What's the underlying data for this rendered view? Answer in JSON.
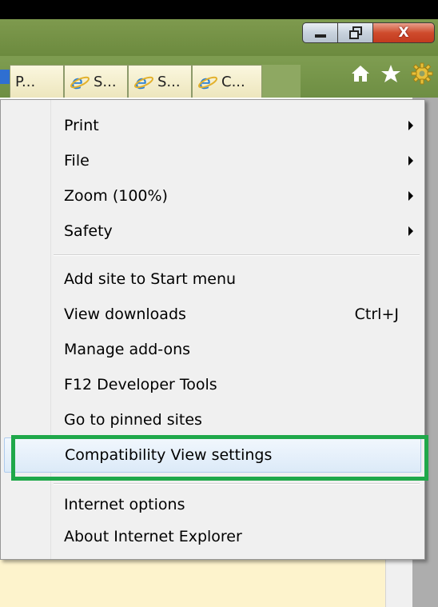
{
  "window": {
    "caption_buttons": {
      "minimize_icon": "minimize-icon",
      "restore_icon": "restore-icon",
      "close_label": "X"
    }
  },
  "tabs": [
    {
      "label": "P...",
      "icon": "none"
    },
    {
      "label": "S...",
      "icon": "ie-icon"
    },
    {
      "label": "S...",
      "icon": "ie-icon"
    },
    {
      "label": "C...",
      "icon": "ie-icon"
    }
  ],
  "toolbar": {
    "icons": [
      "home-icon",
      "star-icon",
      "gear-icon"
    ],
    "gear_color": "#e8c03a"
  },
  "menu": {
    "items_group1": [
      {
        "label": "Print",
        "submenu": true
      },
      {
        "label": "File",
        "submenu": true
      },
      {
        "label": "Zoom (100%)",
        "submenu": true
      },
      {
        "label": "Safety",
        "submenu": true
      }
    ],
    "items_group2": [
      {
        "label": "Add site to Start menu",
        "shortcut": ""
      },
      {
        "label": "View downloads",
        "shortcut": "Ctrl+J"
      },
      {
        "label": "Manage add-ons",
        "shortcut": ""
      },
      {
        "label": "F12 Developer Tools",
        "shortcut": ""
      },
      {
        "label": "Go to pinned sites",
        "shortcut": ""
      },
      {
        "label": "Compatibility View settings",
        "shortcut": "",
        "highlighted": true
      }
    ],
    "items_group3": [
      {
        "label": "Internet options"
      },
      {
        "label": "About Internet Explorer"
      }
    ]
  },
  "colors": {
    "highlight_border": "#1fa84a",
    "tabstrip": "#6e8e43",
    "tab_bg": "#fbf7df"
  }
}
